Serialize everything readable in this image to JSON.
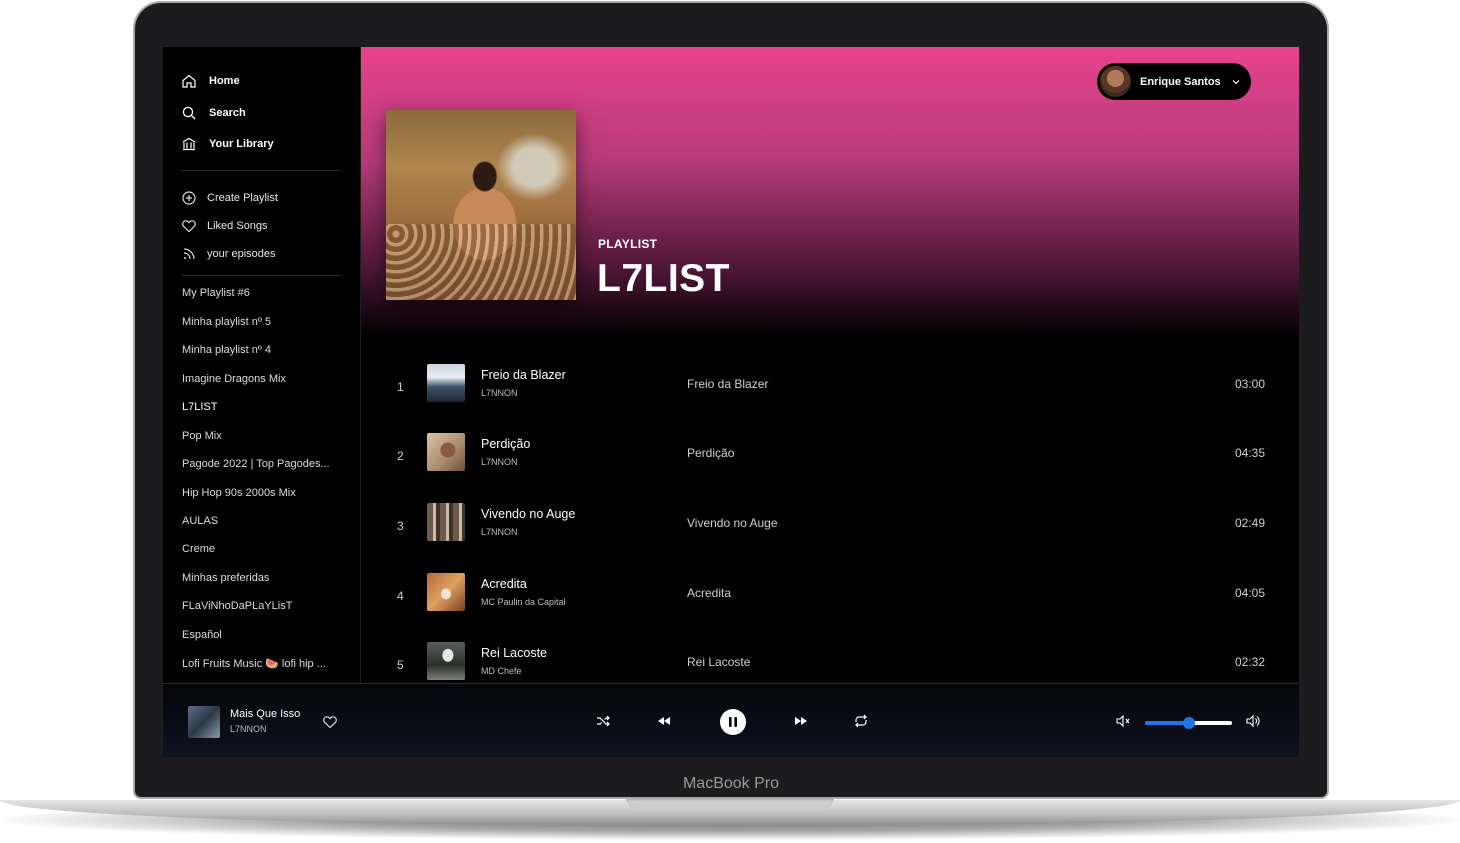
{
  "device": {
    "label": "MacBook Pro"
  },
  "sidebar": {
    "nav": [
      {
        "label": "Home",
        "icon": "home-icon"
      },
      {
        "label": "Search",
        "icon": "search-icon"
      },
      {
        "label": "Your Library",
        "icon": "library-icon"
      }
    ],
    "actions": [
      {
        "label": "Create Playlist",
        "icon": "plus-circle-icon"
      },
      {
        "label": "Liked Songs",
        "icon": "heart-icon"
      },
      {
        "label": "your episodes",
        "icon": "rss-icon"
      }
    ],
    "playlists": [
      "My Playlist #6",
      "Minha playlist nº 5",
      "Minha playlist nº 4",
      "Imagine Dragons Mix",
      "L7LIST",
      "Pop Mix",
      "Pagode 2022 | Top Pagodes...",
      "Hip Hop 90s 2000s Mix",
      "AULAS",
      "Creme",
      "Minhas preferidas",
      "FLaViNhoDaPLaYLisT",
      "Español",
      "Lofi Fruits Music 🍉 lofi hip ..."
    ],
    "active_playlist": "L7LIST"
  },
  "user": {
    "name": "Enrique Santos"
  },
  "hero": {
    "label": "PLAYLIST",
    "title": "L7LIST",
    "gradient_top": "#e8438c"
  },
  "tracks": [
    {
      "num": "1",
      "title": "Freio da Blazer",
      "artist": "L7NNON",
      "album": "Freio da Blazer",
      "duration": "03:00"
    },
    {
      "num": "2",
      "title": "Perdição",
      "artist": "L7NNON",
      "album": "Perdição",
      "duration": "04:35"
    },
    {
      "num": "3",
      "title": "Vivendo no Auge",
      "artist": "L7NNON",
      "album": "Vivendo no Auge",
      "duration": "02:49"
    },
    {
      "num": "4",
      "title": "Acredita",
      "artist": "MC Paulin da Capital",
      "album": "Acredita",
      "duration": "04:05"
    },
    {
      "num": "5",
      "title": "Rei Lacoste",
      "artist": "MD Chefe",
      "album": "Rei Lacoste",
      "duration": "02:32"
    }
  ],
  "now_playing": {
    "title": "Mais Que Isso",
    "artist": "L7NNON",
    "is_playing": true
  },
  "volume": {
    "level": 0.5,
    "accent": "#1e74e6"
  }
}
